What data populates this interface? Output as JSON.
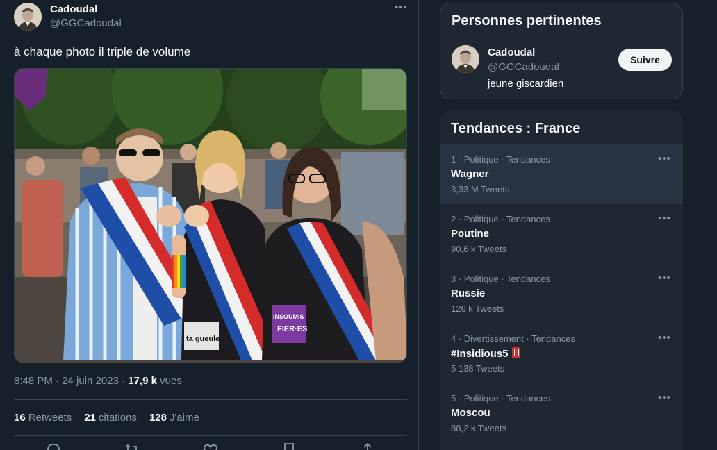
{
  "tweet": {
    "author_name": "Cadoudal",
    "author_handle": "@GGCadoudal",
    "text": "à chaque photo il triple de volume",
    "time": "8:48 PM · 24 juin 2023 · ",
    "views_count": "17,9 k",
    "views_label": " vues",
    "retweets_count": "16",
    "retweets_label": "Retweets",
    "quotes_count": "21",
    "quotes_label": "citations",
    "likes_count": "128",
    "likes_label": "J'aime",
    "more_icon": "more-horizontal-icon",
    "actions": [
      "reply-icon",
      "retweet-icon",
      "like-icon",
      "bookmark-icon",
      "share-icon"
    ]
  },
  "sidebar": {
    "people": {
      "title": "Personnes pertinentes",
      "name": "Cadoudal",
      "handle": "@GGCadoudal",
      "bio": "jeune giscardien",
      "follow_label": "Suivre"
    },
    "trends": {
      "title": "Tendances : France",
      "items": [
        {
          "meta": "1 · Politique · Tendances",
          "name": "Wagner",
          "count": "3,33 M Tweets"
        },
        {
          "meta": "2 · Politique · Tendances",
          "name": "Poutine",
          "count": "90,6 k Tweets"
        },
        {
          "meta": "3 · Politique · Tendances",
          "name": "Russie",
          "count": "126 k Tweets"
        },
        {
          "meta": "4 · Divertissement · Tendances",
          "name": "#Insidious5",
          "count": "5 138 Tweets"
        },
        {
          "meta": "5 · Politique · Tendances",
          "name": "Moscou",
          "count": "88,2 k Tweets"
        }
      ]
    }
  },
  "colors": {
    "background": "#15202b",
    "panel": "#1e2732",
    "text": "#f7f9f9",
    "muted": "#8b98a5",
    "border": "#38444d"
  }
}
